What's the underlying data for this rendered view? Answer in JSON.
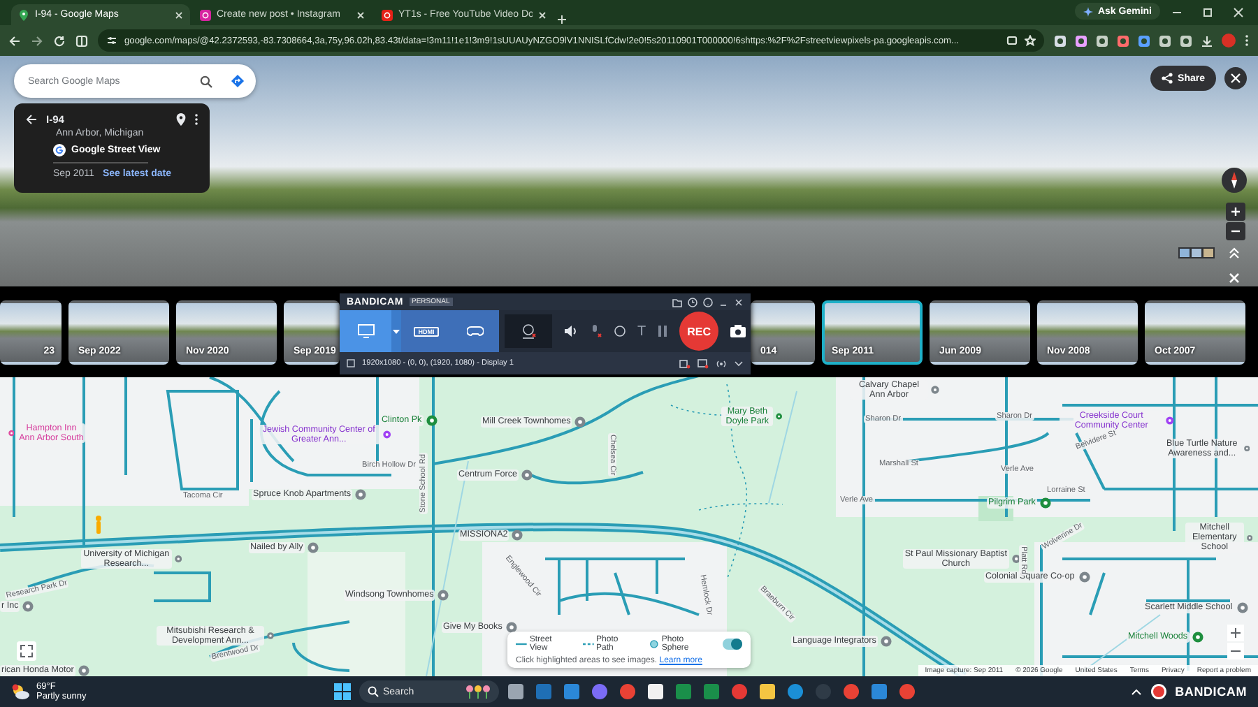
{
  "browser": {
    "tabs": [
      {
        "title": "I-94 - Google Maps",
        "selected": true
      },
      {
        "title": "Create new post • Instagram",
        "selected": false
      },
      {
        "title": "YT1s - Free YouTube Video Do",
        "selected": false
      }
    ],
    "ask_gemini": "Ask Gemini",
    "url": "google.com/maps/@42.2372593,-83.7308664,3a,75y,96.02h,83.43t/data=!3m11!1e1!3m9!1sUUAUyNZGO9lV1NNISLfCdw!2e0!5s20110901T000000!6shttps:%2F%2Fstreetviewpixels-pa.googleapis.com..."
  },
  "street_view": {
    "search": {
      "placeholder": "Search Google Maps"
    },
    "place": {
      "title": "I-94",
      "subtitle": "Ann Arbor, Michigan",
      "source": "Google Street View",
      "date": "Sep 2011",
      "link": "See latest date"
    },
    "share": "Share"
  },
  "timeline": [
    {
      "date": "23",
      "selected": false
    },
    {
      "date": "Sep 2022",
      "selected": false
    },
    {
      "date": "Nov 2020",
      "selected": false
    },
    {
      "date": "Sep 2019",
      "selected": false
    },
    {
      "date": "014",
      "selected": false
    },
    {
      "date": "Sep 2011",
      "selected": true
    },
    {
      "date": "Jun 2009",
      "selected": false
    },
    {
      "date": "Nov 2008",
      "selected": false
    },
    {
      "date": "Oct 2007",
      "selected": false
    }
  ],
  "bandicam": {
    "logo": "BANDICAM",
    "edition": "PERSONAL",
    "hdmi": "HDMI",
    "text_tool": "T",
    "rec": "REC",
    "area_checked": false,
    "area": "1920x1080 - (0, 0), (1920, 1080) - Display 1"
  },
  "map": {
    "places": [
      {
        "name": "Hampton Inn Ann Arbor South",
        "kind": "hotel"
      },
      {
        "name": "Jewish Community Center of Greater Ann...",
        "kind": "community"
      },
      {
        "name": "Clinton Pk",
        "kind": "park"
      },
      {
        "name": "Mill Creek Townhomes",
        "kind": "poi"
      },
      {
        "name": "Mary Beth Doyle Park",
        "kind": "park"
      },
      {
        "name": "Calvary Chapel Ann Arbor",
        "kind": "poi"
      },
      {
        "name": "Sharon Dr",
        "kind": "street"
      },
      {
        "name": "Sharon Dr",
        "kind": "street"
      },
      {
        "name": "Creekside Court Community Center",
        "kind": "community"
      },
      {
        "name": "Blue Turtle Nature Awareness and...",
        "kind": "poi"
      },
      {
        "name": "Marshall St",
        "kind": "street"
      },
      {
        "name": "Verle Ave",
        "kind": "street"
      },
      {
        "name": "Verle Ave",
        "kind": "street"
      },
      {
        "name": "Belvidere St",
        "kind": "street"
      },
      {
        "name": "Lorraine St",
        "kind": "street"
      },
      {
        "name": "Pilgrim Park",
        "kind": "park"
      },
      {
        "name": "Birch Hollow Dr",
        "kind": "street"
      },
      {
        "name": "Centrum Force",
        "kind": "poi"
      },
      {
        "name": "Tacoma Cir",
        "kind": "street"
      },
      {
        "name": "Spruce Knob Apartments",
        "kind": "poi"
      },
      {
        "name": "Stone School Rd",
        "kind": "street"
      },
      {
        "name": "Chelsea Cir",
        "kind": "street"
      },
      {
        "name": "MISSIONA2",
        "kind": "poi"
      },
      {
        "name": "Mitchell Elementary School",
        "kind": "poi"
      },
      {
        "name": "University of Michigan Research...",
        "kind": "poi"
      },
      {
        "name": "Nailed by Ally",
        "kind": "poi"
      },
      {
        "name": "Research Park Dr",
        "kind": "street"
      },
      {
        "name": "r Inc",
        "kind": "poi"
      },
      {
        "name": "Mitsubishi Research & Development Ann...",
        "kind": "poi"
      },
      {
        "name": "Windsong Townhomes",
        "kind": "poi"
      },
      {
        "name": "Give My Books",
        "kind": "poi"
      },
      {
        "name": "Language Integrators",
        "kind": "poi"
      },
      {
        "name": "St Paul Missionary Baptist Church",
        "kind": "poi"
      },
      {
        "name": "Colonial Square Co-op",
        "kind": "poi"
      },
      {
        "name": "Platt Rd",
        "kind": "street"
      },
      {
        "name": "Scarlett Middle School",
        "kind": "poi"
      },
      {
        "name": "Mitchell Woods",
        "kind": "park"
      },
      {
        "name": "rican Honda Motor",
        "kind": "poi"
      },
      {
        "name": "Brentwood Dr",
        "kind": "street"
      },
      {
        "name": "Hemlock Dr",
        "kind": "street"
      },
      {
        "name": "Braeburn Cir",
        "kind": "street"
      },
      {
        "name": "Englewood Cir",
        "kind": "street"
      },
      {
        "name": "Wolverine Dr",
        "kind": "street"
      }
    ],
    "legend": {
      "items": [
        {
          "label": "Street View",
          "kind": "line"
        },
        {
          "label": "Photo Path",
          "kind": "dash"
        },
        {
          "label": "Photo Sphere",
          "kind": "dot"
        }
      ],
      "on": true,
      "hint": "Click highlighted areas to see images.",
      "link": "Learn more"
    },
    "footer": [
      "Image capture: Sep 2011",
      "© 2026 Google",
      "United States",
      "Terms",
      "Privacy",
      "Report a problem"
    ]
  },
  "taskbar": {
    "weather": {
      "temp": "69°F",
      "condition": "Partly sunny"
    },
    "search": {
      "placeholder": "Search"
    },
    "tray_logo": "BANDICAM"
  }
}
